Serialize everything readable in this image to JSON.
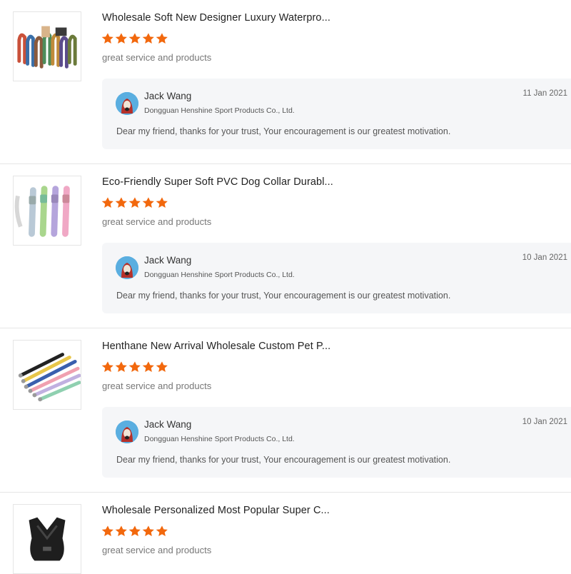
{
  "reviews": [
    {
      "product_title": "Wholesale Soft New Designer Luxury Waterpro...",
      "rating": 5,
      "comment": "great service and products",
      "reply": {
        "author": "Jack Wang",
        "company": "Dongguan Henshine Sport Products Co., Ltd.",
        "date": "11 Jan 2021",
        "message": "Dear my friend, thanks for your trust, Your encouragement is our greatest motivation."
      }
    },
    {
      "product_title": "Eco-Friendly Super Soft PVC Dog Collar Durabl...",
      "rating": 5,
      "comment": "great service and products",
      "reply": {
        "author": "Jack Wang",
        "company": "Dongguan Henshine Sport Products Co., Ltd.",
        "date": "10 Jan 2021",
        "message": "Dear my friend, thanks for your trust, Your encouragement is our greatest motivation."
      }
    },
    {
      "product_title": "Henthane New Arrival Wholesale Custom Pet P...",
      "rating": 5,
      "comment": "great service and products",
      "reply": {
        "author": "Jack Wang",
        "company": "Dongguan Henshine Sport Products Co., Ltd.",
        "date": "10 Jan 2021",
        "message": "Dear my friend, thanks for your trust, Your encouragement is our greatest motivation."
      }
    },
    {
      "product_title": "Wholesale Personalized Most Popular Super C...",
      "rating": 5,
      "comment": "great service and products"
    }
  ],
  "colors": {
    "star": "#f2680d",
    "reply_bg": "#f5f6f8",
    "avatar_bg": "#5aaee0"
  },
  "icons": {
    "star": "star-icon",
    "avatar": "avatar-icon"
  }
}
